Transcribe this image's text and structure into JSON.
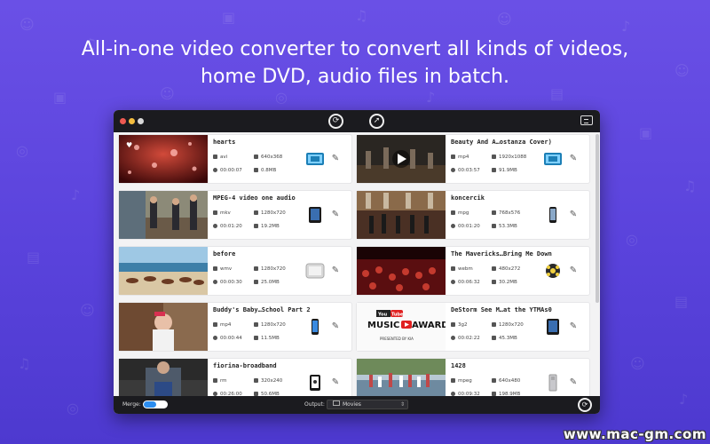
{
  "headline": {
    "line1": "All-in-one video converter to convert all kinds of videos,",
    "line2": "home DVD, audio files in batch."
  },
  "toolbar": {
    "convert_icon": "convert-icon",
    "share_icon": "share-icon",
    "right_icon": "media-browser-icon"
  },
  "files": [
    {
      "title": "hearts",
      "format": "avi",
      "resolution": "640x368",
      "duration": "00:00:07",
      "size": "0.8MB",
      "device": "video-format-icon"
    },
    {
      "title": "Beauty And A…ostanza Cover)",
      "format": "mp4",
      "resolution": "1920x1088",
      "duration": "00:03:57",
      "size": "91.9MB",
      "device": "video-format-icon"
    },
    {
      "title": "MPEG-4 video one audio",
      "format": "mkv",
      "resolution": "1280x720",
      "duration": "00:01:20",
      "size": "19.2MB",
      "device": "ipad-icon"
    },
    {
      "title": "koncercik",
      "format": "mpg",
      "resolution": "768x576",
      "duration": "00:01:20",
      "size": "53.3MB",
      "device": "iphone-icon"
    },
    {
      "title": "before",
      "format": "wmv",
      "resolution": "1280x720",
      "duration": "00:00:30",
      "size": "25.0MB",
      "device": "apple-tv-icon"
    },
    {
      "title": "The Mavericks…Bring Me Down",
      "format": "webm",
      "resolution": "480x272",
      "duration": "00:06:32",
      "size": "30.2MB",
      "device": "film-reel-icon"
    },
    {
      "title": "Buddy's Baby…School Part 2",
      "format": "mp4",
      "resolution": "1280x720",
      "duration": "00:00:44",
      "size": "11.5MB",
      "device": "phone-icon"
    },
    {
      "title": "DeStorm See M…at the YTMAs0",
      "format": "3g2",
      "resolution": "1280x720",
      "duration": "00:02:22",
      "size": "45.3MB",
      "device": "ipad-icon"
    },
    {
      "title": "fiorina-broadband",
      "format": "rm",
      "resolution": "320x240",
      "duration": "00:26:00",
      "size": "50.6MB",
      "device": "tablet-icon"
    },
    {
      "title": "1428",
      "format": "mpeg",
      "resolution": "640x480",
      "duration": "00:09:32",
      "size": "198.9MB",
      "device": "mac-pro-icon"
    }
  ],
  "thumb_overlay": {
    "youtube": "You",
    "youtube_tube": "Tube",
    "music": "MUSIC",
    "awards": "AWARDS",
    "presented_by": "PRESENTED BY KIA"
  },
  "bottom": {
    "merge_label": "Merge:",
    "merge_on": true,
    "output_label": "Output:",
    "output_value": "Movies"
  },
  "watermark": "www.mac-gm.com",
  "colors": {
    "background": "#5a43dc",
    "window_bar": "#1b1b1f",
    "accent": "#2b8df0"
  }
}
